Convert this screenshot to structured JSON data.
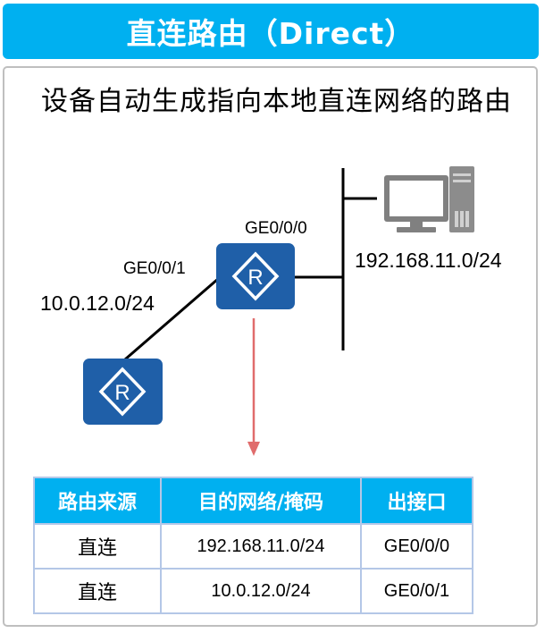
{
  "title": "直连路由（Direct）",
  "subtitle": "设备自动生成指向本地直连网络的路由",
  "diagram": {
    "router_main": {
      "icon": "router-icon",
      "glyph": "R",
      "color": "#1f5fa8"
    },
    "router_left": {
      "icon": "router-icon",
      "glyph": "R",
      "color": "#1f5fa8"
    },
    "pc": {
      "icon": "computer-icon"
    },
    "labels": {
      "ge000": "GE0/0/0",
      "ge001": "GE0/0/1",
      "net_left": "10.0.12.0/24",
      "net_right": "192.168.11.0/24"
    },
    "arrow_color": "#e06c6c"
  },
  "table": {
    "headers": [
      "路由来源",
      "目的网络/掩码",
      "出接口"
    ],
    "rows": [
      [
        "直连",
        "192.168.11.0/24",
        "GE0/0/0"
      ],
      [
        "直连",
        "10.0.12.0/24",
        "GE0/0/1"
      ]
    ],
    "header_color": "#00b0f0"
  }
}
